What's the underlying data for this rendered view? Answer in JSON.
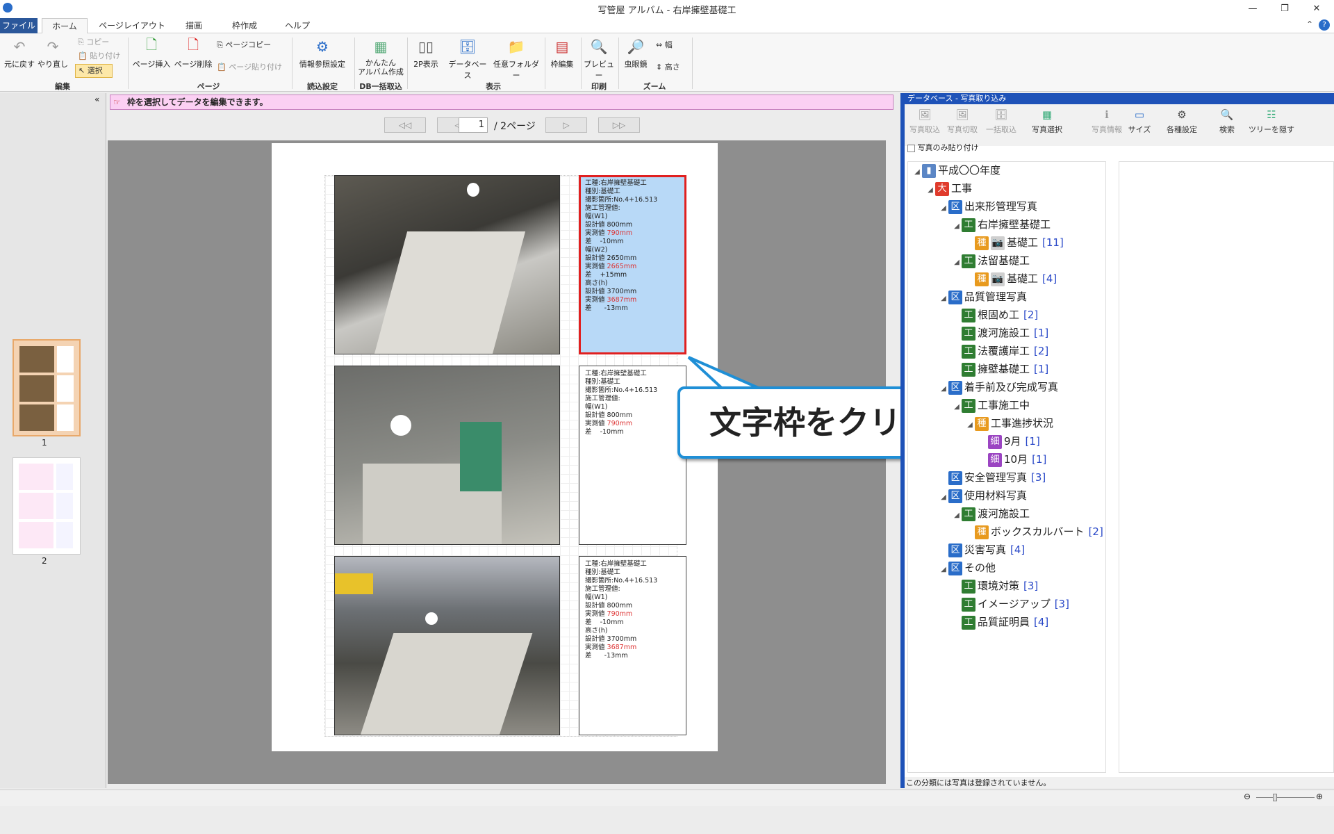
{
  "window": {
    "title": "写管屋 アルバム - 右岸擁壁基礎工",
    "min": "—",
    "max": "❐",
    "close": "✕"
  },
  "tabs": [
    "ファイル",
    "ホーム",
    "ページレイアウト",
    "描画",
    "枠作成",
    "ヘルプ"
  ],
  "ribbon": {
    "undo": "元に戻す",
    "redo": "やり直し",
    "copy": "コピー",
    "paste": "貼り付け",
    "select": "選択",
    "page_insert": "ページ挿入",
    "page_delete": "ページ削除",
    "page_copy": "ページコピー",
    "page_paste": "ページ貼り付け",
    "info_ref": "情報参照設定",
    "easy_album_1": "かんたん",
    "easy_album_2": "アルバム作成",
    "p2": "2P表示",
    "database": "データベース",
    "folder": "任意フォルダー",
    "frame_edit": "枠編集",
    "preview": "プレビュー",
    "magnifier": "虫眼鏡",
    "width": "幅",
    "height": "高さ",
    "groups": {
      "edit": "編集",
      "page": "ページ",
      "read": "読込設定",
      "db": "DB一括取込",
      "view": "表示",
      "print": "印刷",
      "zoom": "ズーム"
    }
  },
  "hint": "枠を選択してデータを編集できます。",
  "pager": {
    "first": "◁◁",
    "prev": "◁",
    "current": "1",
    "total": "/ 2ページ",
    "next": "▷",
    "last": "▷▷"
  },
  "thumbs": [
    "1",
    "2"
  ],
  "text_boxes": [
    {
      "lines": [
        "工種:右岸擁壁基礎工",
        "種別:基礎工",
        "撮影箇所:No.4+16.513",
        "施工管理値:",
        "幅(W1)",
        "設計値 800mm",
        "実測値 790mm",
        "差    -10mm",
        "幅(W2)",
        "設計値 2650mm",
        "実測値 2665mm",
        "差    +15mm",
        "高さ(h)",
        "設計値 3700mm",
        "実測値 3687mm",
        "差      -13mm"
      ]
    },
    {
      "lines": [
        "工種:右岸擁壁基礎工",
        "種別:基礎工",
        "撮影箇所:No.4+16.513",
        "施工管理値:",
        "幅(W1)",
        "設計値 800mm",
        "実測値 790mm",
        "差    -10mm"
      ]
    },
    {
      "lines": [
        "工種:右岸擁壁基礎工",
        "種別:基礎工",
        "撮影箇所:No.4+16.513",
        "施工管理値:",
        "幅(W1)",
        "設計値 800mm",
        "実測値 790mm",
        "差    -10mm",
        "高さ(h)",
        "設計値 3700mm",
        "実測値 3687mm",
        "差      -13mm"
      ]
    }
  ],
  "callout": "文字枠をクリックします",
  "right_pane": {
    "title": "データベース - 写真取り込み",
    "tools": [
      "写真取込",
      "写真切取",
      "一括取込",
      "写真選択",
      "写真情報",
      "サイズ",
      "各種設定",
      "検索",
      "ツリーを隠す"
    ],
    "paste_only": "写真のみ貼り付け",
    "status": "この分類には写真は登録されていません。"
  },
  "tree": [
    {
      "label": "平成〇〇年度",
      "tag": "",
      "count": ""
    },
    {
      "label": "工事",
      "tag": "大",
      "count": ""
    },
    {
      "label": "出来形管理写真",
      "tag": "区",
      "count": ""
    },
    {
      "label": "右岸擁壁基礎工",
      "tag": "工",
      "count": ""
    },
    {
      "label": "基礎工",
      "tag": "種",
      "count": "[11]"
    },
    {
      "label": "法留基礎工",
      "tag": "工",
      "count": ""
    },
    {
      "label": "基礎工",
      "tag": "種",
      "count": "[4]"
    },
    {
      "label": "品質管理写真",
      "tag": "区",
      "count": ""
    },
    {
      "label": "根固め工",
      "tag": "工",
      "count": "[2]"
    },
    {
      "label": "渡河施設工",
      "tag": "工",
      "count": "[1]"
    },
    {
      "label": "法覆護岸工",
      "tag": "工",
      "count": "[2]"
    },
    {
      "label": "擁壁基礎工",
      "tag": "工",
      "count": "[1]"
    },
    {
      "label": "着手前及び完成写真",
      "tag": "区",
      "count": ""
    },
    {
      "label": "工事施工中",
      "tag": "工",
      "count": ""
    },
    {
      "label": "工事進捗状況",
      "tag": "種",
      "count": ""
    },
    {
      "label": "9月",
      "tag": "細",
      "count": "[1]"
    },
    {
      "label": "10月",
      "tag": "細",
      "count": "[1]"
    },
    {
      "label": "安全管理写真",
      "tag": "区",
      "count": "[3]"
    },
    {
      "label": "使用材料写真",
      "tag": "区",
      "count": ""
    },
    {
      "label": "渡河施設工",
      "tag": "工",
      "count": ""
    },
    {
      "label": "ボックスカルバート",
      "tag": "種",
      "count": "[2]"
    },
    {
      "label": "災害写真",
      "tag": "区",
      "count": "[4]"
    },
    {
      "label": "その他",
      "tag": "区",
      "count": ""
    },
    {
      "label": "環境対策",
      "tag": "工",
      "count": "[3]"
    },
    {
      "label": "イメージアップ",
      "tag": "工",
      "count": "[3]"
    },
    {
      "label": "品質証明員",
      "tag": "工",
      "count": "[4]"
    }
  ]
}
